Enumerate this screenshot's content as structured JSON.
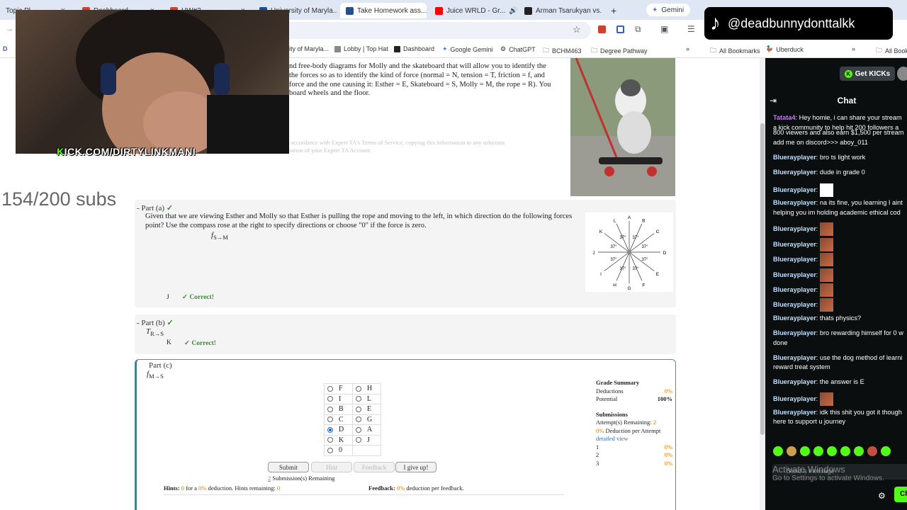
{
  "tabs": [
    "Topic Pl...",
    "Dashboard",
    "HW#3",
    "University of Maryla...",
    "Take Homework ass...",
    "Juice WRLD - Gr...",
    "Arman Tsarukyan vs..."
  ],
  "gemini_label": "Gemini",
  "bookmarks": [
    "ity of Maryla...",
    "Lobby | Top Hat",
    "Dashboard",
    "Google Gemini",
    "ChatGPT",
    "BCHM463",
    "Degree Pathway",
    "All Bookmarks",
    "Uberduck",
    "All Book"
  ],
  "tiktok_handle": "@deadbunnydonttalkk",
  "kick_overlay": {
    "k": "K",
    "rest": "ICK.COM/DIRTYLINKMANI"
  },
  "subs": "154/200 subs",
  "intro": {
    "line1": "nd free-body diagrams for Molly and the skateboard that will allow you to identify the",
    "line2": "the forces so as to identify the kind of force (normal = N, tension = T, friction = f, and",
    "line3": "force and the one causing it: Esther = E, Skateboard = S, Molly = M, the rope = R). You",
    "line4": "board wheels and the floor.",
    "faint1": "9435. In accordance with Expert TA's Terms of Service, copying this information to any solutions",
    "faint2": "in termination of your Expert TA Account."
  },
  "part_a": {
    "title": "Part (a)",
    "check": "✓",
    "question": "Given that we are viewing Esther and Molly so that Esther is pulling the rope and moving to the left, in which direction do the following forces point? Use the compass rose at the right to specify directions or choose \"0\" if the force is zero.",
    "force_sym": "f",
    "force_sub": "S→M",
    "answer": "J",
    "correct": "✓ Correct!"
  },
  "compass": {
    "letters": [
      "A",
      "B",
      "C",
      "D",
      "E",
      "F",
      "G",
      "H",
      "I",
      "J",
      "K",
      "L"
    ],
    "angle": "37°"
  },
  "part_b": {
    "title": "Part (b)",
    "check": "✓",
    "force_sym": "T",
    "force_sub": "R→S",
    "answer": "K",
    "correct": "✓ Correct!"
  },
  "part_c": {
    "title": "Part (c)",
    "force_sym": "f",
    "force_sub": "M→S",
    "options": [
      [
        "F",
        "H"
      ],
      [
        "I",
        "L"
      ],
      [
        "B",
        "E"
      ],
      [
        "C",
        "G"
      ],
      [
        "D",
        "A"
      ],
      [
        "K",
        "J"
      ],
      [
        "0",
        ""
      ]
    ],
    "selected": "D",
    "buttons": {
      "submit": "Submit",
      "hint": "Hint",
      "feedback": "Feedback",
      "giveup": "I give up!"
    },
    "remaining_count": "2",
    "remaining_text": "Submission(s) Remaining",
    "hints_label": "Hints:",
    "hints_value": "0",
    "hints_for": "for a",
    "hints_pct": "0%",
    "hints_tail": "deduction. Hints remaining:",
    "hints_remaining": "0",
    "feedback_label": "Feedback:",
    "feedback_pct": "0%",
    "feedback_tail": "deduction per feedback."
  },
  "grade_summary": {
    "title": "Grade Summary",
    "deductions_label": "Deductions",
    "deductions": "0%",
    "potential_label": "Potential",
    "potential": "100%",
    "submissions_title": "Submissions",
    "attempts_label": "Attempt(s) Remaining:",
    "attempts": "2",
    "per_attempt_pct": "0%",
    "per_attempt_label": "Deduction per Attempt",
    "detailed": "detailed view",
    "rows": [
      [
        "1",
        "0%"
      ],
      [
        "2",
        "0%"
      ],
      [
        "3",
        "0%"
      ]
    ]
  },
  "chat": {
    "get_kicks": "Get KICKs",
    "title": "Chat",
    "messages": [
      {
        "user": "Tatata4",
        "text": "Hey homie, i can share your stream",
        "cont": "a kick community to help hit 200 followers a"
      },
      {
        "user": "",
        "text": "800 viewers and also earn $1,500 per stream",
        "cont": "add me on discord>>> aboy_011"
      },
      {
        "user": "Bluerayplayer",
        "text": "bro ts light work"
      },
      {
        "user": "Bluerayplayer",
        "text": "dude in grade 0"
      },
      {
        "user": "Bluerayplayer",
        "text": ""
      },
      {
        "user": "Bluerayplayer",
        "text": "na its fine, you learning I aint",
        "cont": "helping you im holding academic ethical cod"
      },
      {
        "user": "Bluerayplayer",
        "text": ""
      },
      {
        "user": "Bluerayplayer",
        "text": ""
      },
      {
        "user": "Bluerayplayer",
        "text": ""
      },
      {
        "user": "Bluerayplayer",
        "text": ""
      },
      {
        "user": "Bluerayplayer",
        "text": ""
      },
      {
        "user": "Bluerayplayer",
        "text": ""
      },
      {
        "user": "Bluerayplayer",
        "text": "thats physics?"
      },
      {
        "user": "Bluerayplayer",
        "text": "bro rewarding himself for 0 w",
        "cont": "done"
      },
      {
        "user": "Bluerayplayer",
        "text": "use the dog method of learni",
        "cont": "reward treat system"
      },
      {
        "user": "Bluerayplayer",
        "text": "the answer is E"
      },
      {
        "user": "Bluerayplayer",
        "text": ""
      },
      {
        "user": "Bluerayplayer",
        "text": "idk this shit you got it though",
        "cont": "here to support u journey"
      }
    ],
    "send_placeholder": "Send a message",
    "send_button": "Ch"
  },
  "windows_activation": {
    "title": "Activate Windows",
    "sub": "Go to Settings to activate Windows."
  }
}
